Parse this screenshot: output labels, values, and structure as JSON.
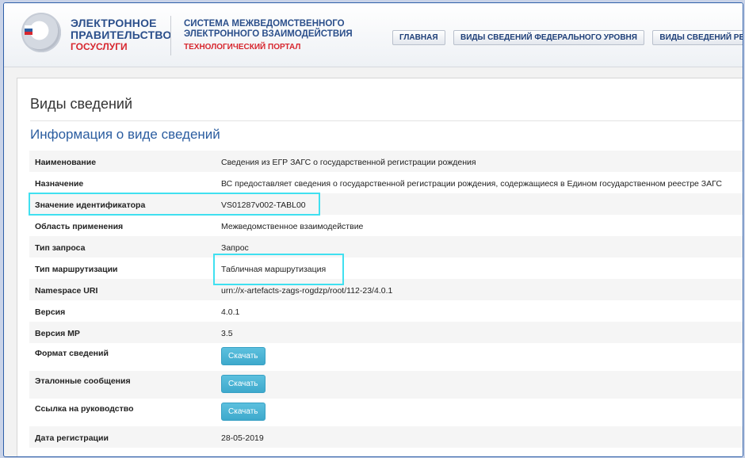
{
  "header": {
    "brand_line1": "ЭЛЕКТРОННОЕ",
    "brand_line2": "ПРАВИТЕЛЬСТВО",
    "brand_line3": "ГОСУСЛУГИ",
    "system_line1": "СИСТЕМА МЕЖВЕДОМСТВЕННОГО",
    "system_line2": "ЭЛЕКТРОННОГО ВЗАИМОДЕЙСТВИЯ",
    "system_line3": "ТЕХНОЛОГИЧЕСКИЙ ПОРТАЛ",
    "nav": [
      "ГЛАВНАЯ",
      "ВИДЫ СВЕДЕНИЙ ФЕДЕРАЛЬНОГО УРОВНЯ",
      "ВИДЫ СВЕДЕНИЙ РЕГИОН"
    ]
  },
  "page": {
    "title": "Виды сведений",
    "section_title": "Информация о виде сведений"
  },
  "info": [
    {
      "key": "Наименование",
      "value": "Сведения из ЕГР ЗАГС о государственной регистрации рождения"
    },
    {
      "key": "Назначение",
      "value": "ВС предоставляет сведения о государственной регистрации рождения, содержащиеся в Едином государственном реестре ЗАГС"
    },
    {
      "key": "Значение идентификатора",
      "value": "VS01287v002-TABL00"
    },
    {
      "key": "Область применения",
      "value": "Межведомственное взаимодействие"
    },
    {
      "key": "Тип запроса",
      "value": "Запрос"
    },
    {
      "key": "Тип маршрутизации",
      "value": "Табличная маршрутизация"
    },
    {
      "key": "Namespace URI",
      "value": "urn://x-artefacts-zags-rogdzp/root/112-23/4.0.1"
    },
    {
      "key": "Версия",
      "value": "4.0.1"
    },
    {
      "key": "Версия МР",
      "value": "3.5"
    },
    {
      "key": "Формат сведений",
      "button": "Скачать"
    },
    {
      "key": "Эталонные сообщения",
      "button": "Скачать"
    },
    {
      "key": "Ссылка на руководство",
      "button": "Скачать"
    },
    {
      "key": "Дата регистрации",
      "value": "28-05-2019"
    }
  ],
  "colors": {
    "highlight": "#40e0f0",
    "brand_blue": "#2b4f8b",
    "brand_red": "#d7262e",
    "button": "#4ab3d4"
  }
}
